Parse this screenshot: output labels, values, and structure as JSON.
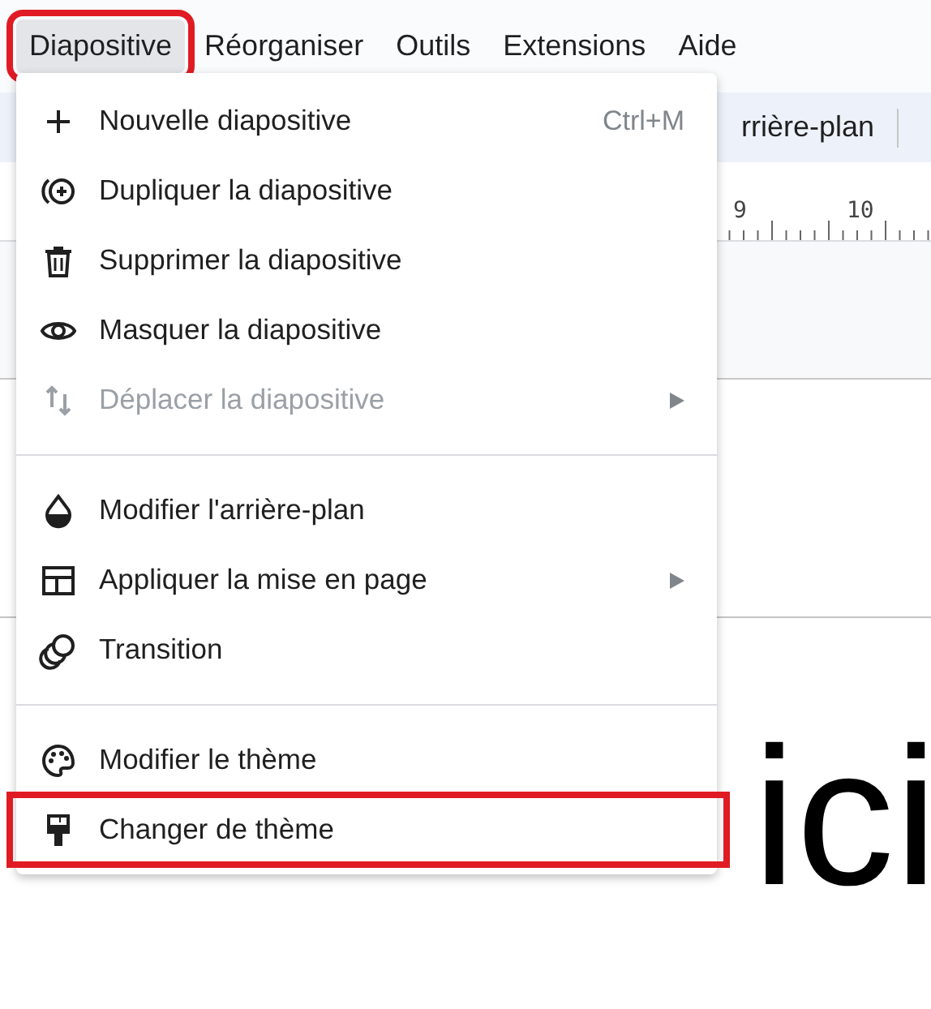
{
  "menubar": [
    {
      "label": "Diapositive",
      "selected": true,
      "highlighted": true
    },
    {
      "label": "Réorganiser",
      "selected": false,
      "highlighted": false
    },
    {
      "label": "Outils",
      "selected": false,
      "highlighted": false
    },
    {
      "label": "Extensions",
      "selected": false,
      "highlighted": false
    },
    {
      "label": "Aide",
      "selected": false,
      "highlighted": false
    }
  ],
  "toolbar": {
    "items": [
      "rrière-plan"
    ]
  },
  "ruler": {
    "labels": [
      "9",
      "10"
    ]
  },
  "slide": {
    "title": "ici"
  },
  "menu": {
    "groups": [
      {
        "items": [
          {
            "label": "Nouvelle diapositive",
            "shortcut": "Ctrl+M",
            "disabled": false,
            "submenu": false,
            "highlighted": false
          },
          {
            "label": "Dupliquer la diapositive",
            "disabled": false,
            "submenu": false,
            "highlighted": false
          },
          {
            "label": "Supprimer la diapositive",
            "disabled": false,
            "submenu": false,
            "highlighted": false
          },
          {
            "label": "Masquer la diapositive",
            "disabled": false,
            "submenu": false,
            "highlighted": false
          },
          {
            "label": "Déplacer la diapositive",
            "disabled": true,
            "submenu": true,
            "highlighted": false
          }
        ]
      },
      {
        "items": [
          {
            "label": "Modifier l'arrière-plan",
            "disabled": false,
            "submenu": false,
            "highlighted": false
          },
          {
            "label": "Appliquer la mise en page",
            "disabled": false,
            "submenu": true,
            "highlighted": false
          },
          {
            "label": "Transition",
            "disabled": false,
            "submenu": false,
            "highlighted": false
          }
        ]
      },
      {
        "items": [
          {
            "label": "Modifier le thème",
            "disabled": false,
            "submenu": false,
            "highlighted": false
          },
          {
            "label": "Changer de thème",
            "disabled": false,
            "submenu": false,
            "highlighted": true
          }
        ]
      }
    ]
  }
}
